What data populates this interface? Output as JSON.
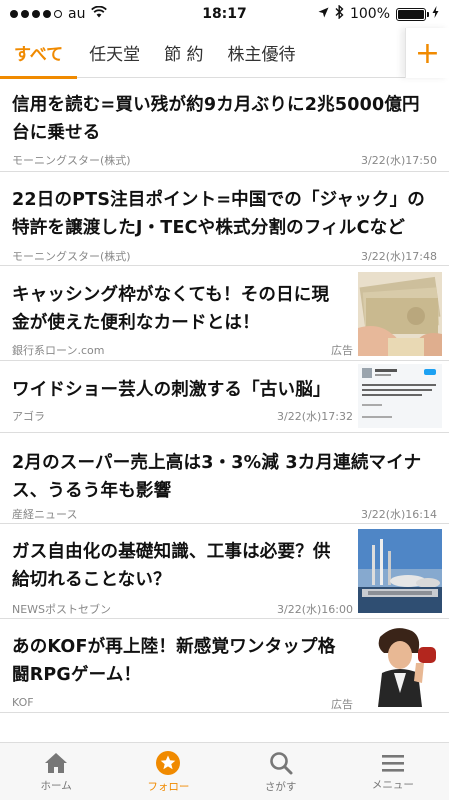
{
  "status_bar": {
    "carrier": "au",
    "time": "18:17",
    "battery": "100%"
  },
  "tabs": [
    {
      "label": "すべて"
    },
    {
      "label": "任天堂"
    },
    {
      "label": "節 約"
    },
    {
      "label": "株主優待"
    }
  ],
  "add_tab_label": "+",
  "articles": [
    {
      "title": "信用を読む=買い残が約9カ月ぶりに2兆5000億円台に乗せる",
      "source": "モーニングスター(株式)",
      "time": "3/22(水)17:50"
    },
    {
      "title": "22日のPTS注目ポイント=中国での「ジャック」の特許を譲渡したJ・TECや株式分割のフィルCなど",
      "source": "モーニングスター(株式)",
      "time": "3/22(水)17:48"
    },
    {
      "title": "キャッシング枠がなくても！その日に現金が使えた便利なカードとは！",
      "source": "銀行系ローン.com",
      "time": "広告"
    },
    {
      "title": "ワイドショー芸人の刺激する「古い脳」",
      "source": "アゴラ",
      "time": "3/22(水)17:32"
    },
    {
      "title": "2月のスーパー売上高は3・3%減 3カ月連続マイナス、うるう年も影響",
      "source": "産経ニュース",
      "time": "3/22(水)16:14"
    },
    {
      "title": "ガス自由化の基礎知識、工事は必要？供給切れることない？",
      "source": "NEWSポストセブン",
      "time": "3/22(水)16:00"
    },
    {
      "title": "あのKOFが再上陸！新感覚ワンタップ格闘RPGゲーム！",
      "source": "KOF",
      "time": "広告"
    }
  ],
  "bottom_nav": [
    {
      "label": "ホーム",
      "icon": "home-icon"
    },
    {
      "label": "フォロー",
      "icon": "star-icon"
    },
    {
      "label": "さがす",
      "icon": "search-icon"
    },
    {
      "label": "メニュー",
      "icon": "menu-icon"
    }
  ],
  "colors": {
    "accent": "#f08a00",
    "text": "#111111",
    "meta": "#888888"
  }
}
